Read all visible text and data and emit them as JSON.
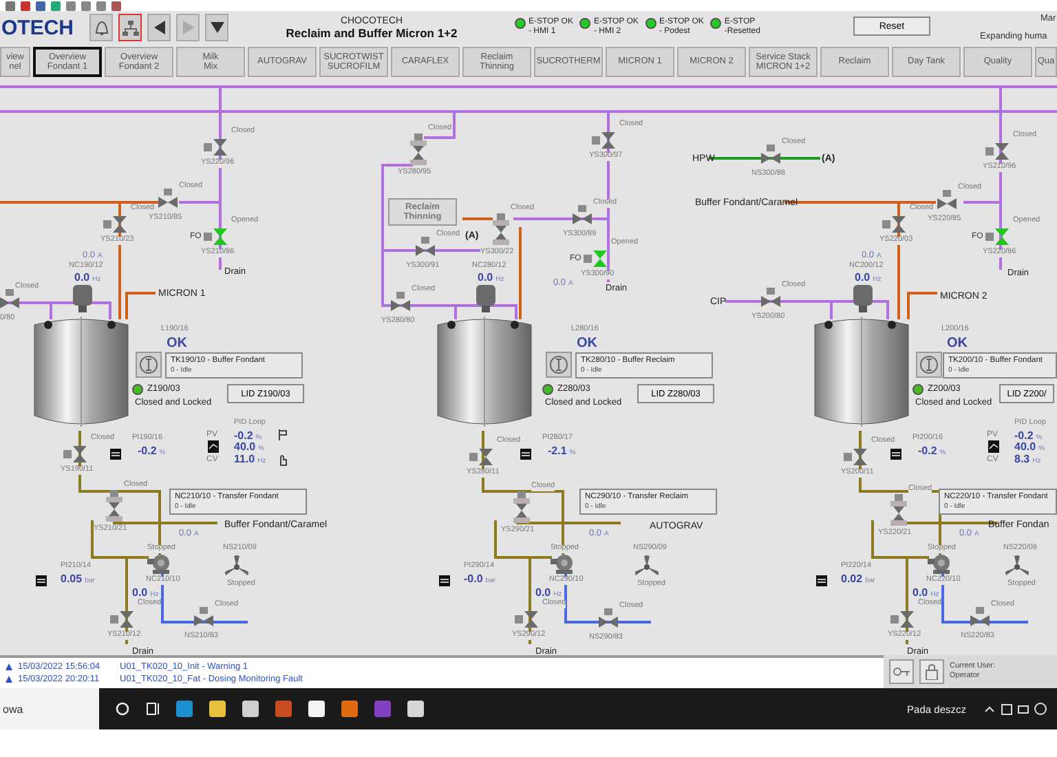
{
  "header": {
    "logo": "OTECH",
    "title_top": "CHOCOTECH",
    "title": "Reclaim and Buffer Micron 1+2",
    "estops": [
      {
        "label": "E-STOP OK",
        "sub": "- HMI 1",
        "color": "#22cc22"
      },
      {
        "label": "E-STOP OK",
        "sub": "- HMI 2",
        "color": "#22cc22"
      },
      {
        "label": "E-STOP OK",
        "sub": "- Podest",
        "color": "#22cc22"
      },
      {
        "label": "E-STOP",
        "sub": "-Resetted",
        "color": "#22cc22"
      }
    ],
    "reset": "Reset",
    "user_short": "Mar",
    "project": "Expanding huma"
  },
  "nav_tabs": [
    {
      "lines": [
        "view",
        "nel"
      ],
      "selected": false
    },
    {
      "lines": [
        "Overview",
        "Fondant 1"
      ],
      "selected": true
    },
    {
      "lines": [
        "Overview",
        "Fondant 2"
      ],
      "selected": false
    },
    {
      "lines": [
        "Milk",
        "Mix"
      ],
      "selected": false
    },
    {
      "lines": [
        "AUTOGRAV"
      ],
      "selected": false
    },
    {
      "lines": [
        "SUCROTWIST",
        "SUCROFILM"
      ],
      "selected": false
    },
    {
      "lines": [
        "CARAFLEX"
      ],
      "selected": false
    },
    {
      "lines": [
        "Reclaim",
        "Thinning"
      ],
      "selected": false
    },
    {
      "lines": [
        "SUCROTHERM"
      ],
      "selected": false
    },
    {
      "lines": [
        "MICRON 1"
      ],
      "selected": false
    },
    {
      "lines": [
        "MICRON 2"
      ],
      "selected": false
    },
    {
      "lines": [
        "Service Stack",
        "MICRON 1+2"
      ],
      "selected": false
    },
    {
      "lines": [
        "Reclaim"
      ],
      "selected": false
    },
    {
      "lines": [
        "Day Tank"
      ],
      "selected": false
    },
    {
      "lines": [
        "Quality"
      ],
      "selected": false
    },
    {
      "lines": [
        "Qua"
      ],
      "selected": false
    }
  ],
  "diagram": {
    "tanks": [
      {
        "level_tag": "L190/16",
        "level_status": "OK"
      },
      {
        "level_tag": "L280/16",
        "level_status": "OK"
      },
      {
        "level_tag": "L200/16",
        "level_status": "OK"
      }
    ],
    "motors": [
      {
        "tag": "NC190/12",
        "value": "0.0",
        "unit": "Hz"
      },
      {
        "tag": "NC280/12",
        "value": "0.0",
        "unit": "Hz"
      },
      {
        "tag": "NC200/12",
        "value": "0.0",
        "unit": "Hz"
      }
    ],
    "motor_currents": [
      {
        "value": "0.0",
        "unit": "A"
      },
      {
        "value": "0.0",
        "unit": "A"
      },
      {
        "value": "0.0",
        "unit": "A"
      }
    ],
    "tank_panels": [
      {
        "title": "TK190/10 - Buffer Fondant",
        "status": "0 - Idle"
      },
      {
        "title": "TK280/10 - Buffer Reclaim",
        "status": "0 - Idle"
      },
      {
        "title": "TK200/10 - Buffer Fondant",
        "status": "0 - Idle"
      }
    ],
    "locks": [
      {
        "tag": "Z190/03",
        "status": "Closed and Locked",
        "locked": true,
        "button": "LID Z190/03"
      },
      {
        "tag": "Z280/03",
        "status": "Closed and Locked",
        "locked": true,
        "button": "LID Z280/03"
      },
      {
        "tag": "Z200/03",
        "status": "Closed and Locked",
        "locked": true,
        "button": "LID Z200/"
      }
    ],
    "level_readings": [
      {
        "tag": "PI190/16",
        "value": "-0.2",
        "unit": "%"
      },
      {
        "tag": "PI280/17",
        "value": "-2.1",
        "unit": "%"
      },
      {
        "tag": "PI200/16",
        "value": "-0.2",
        "unit": "%"
      }
    ],
    "pid_loops": [
      {
        "title": "PID Loop",
        "pv_label": "PV",
        "pv": "-0.2",
        "pv_unit": "%",
        "sp": "40.0",
        "sp_unit": "%",
        "cv_label": "CV",
        "cv": "11.0",
        "cv_unit": "Hz"
      },
      {
        "title": "PID Loop",
        "pv_label": "PV",
        "pv": "-0.2",
        "pv_unit": "%",
        "sp": "40.0",
        "sp_unit": "%",
        "cv_label": "CV",
        "cv": "8.3",
        "cv_unit": "Hz"
      }
    ],
    "transfer_panels": [
      {
        "title": "NC210/10 - Transfer Fondant",
        "status": "0 - Idle"
      },
      {
        "title": "NC290/10 - Transfer Reclaim",
        "status": "0 - Idle"
      },
      {
        "title": "NC220/10 - Transfer Fondant",
        "status": "0 - Idle"
      }
    ],
    "pump_currents": [
      {
        "value": "0.0",
        "unit": "A"
      },
      {
        "value": "0.0",
        "unit": "A"
      },
      {
        "value": "0.0",
        "unit": "A"
      }
    ],
    "pumps": [
      {
        "tag": "NC210/10",
        "state": "Stopped",
        "value": "0.0",
        "unit": "Hz"
      },
      {
        "tag": "NC290/10",
        "state": "Stopped",
        "value": "0.0",
        "unit": "Hz"
      },
      {
        "tag": "NC220/10",
        "state": "Stopped",
        "value": "0.0",
        "unit": "Hz"
      }
    ],
    "fans": [
      {
        "tag": "NS210/09",
        "state": "Stopped"
      },
      {
        "tag": "NS290/09",
        "state": "Stopped"
      },
      {
        "tag": "NS220/09",
        "state": "Stopped"
      }
    ],
    "pressures": [
      {
        "tag": "PI210/14",
        "value": "0.05",
        "unit": "bar"
      },
      {
        "tag": "PI290/14",
        "value": "-0.0",
        "unit": "bar"
      },
      {
        "tag": "PI220/14",
        "value": "0.02",
        "unit": "bar"
      }
    ],
    "valves": [
      {
        "tag": "YS220/96",
        "state": "Closed",
        "open": false
      },
      {
        "tag": "YS210/85",
        "state": "Closed",
        "open": false
      },
      {
        "tag": "YS210/23",
        "state": "Closed",
        "open": false
      },
      {
        "tag": "YS210/86",
        "state": "Opened",
        "open": true,
        "prefix": "FO"
      },
      {
        "tag": "0/80",
        "state": "Closed",
        "open": false
      },
      {
        "tag": "YS190/11",
        "state": "Closed",
        "open": false
      },
      {
        "tag": "YS210/21",
        "state": "Closed",
        "open": false
      },
      {
        "tag": "YS210/12",
        "state": "Closed",
        "open": false
      },
      {
        "tag": "NS210/83",
        "state": "Closed",
        "open": false
      },
      {
        "tag": "YS280/95",
        "state": "Closed",
        "open": false
      },
      {
        "tag": "YS300/97",
        "state": "Closed",
        "open": false
      },
      {
        "tag": "YS300/89",
        "state": "Closed",
        "open": false
      },
      {
        "tag": "YS300/22",
        "state": "Closed",
        "open": false
      },
      {
        "tag": "YS300/91",
        "state": "Closed",
        "open": false
      },
      {
        "tag": "YS300/90",
        "state": "Opened",
        "open": true,
        "prefix": "FO"
      },
      {
        "tag": "YS280/80",
        "state": "Closed",
        "open": false
      },
      {
        "tag": "YS280/11",
        "state": "Closed",
        "open": false
      },
      {
        "tag": "YS290/21",
        "state": "Closed",
        "open": false
      },
      {
        "tag": "YS290/12",
        "state": "Closed",
        "open": false
      },
      {
        "tag": "NS290/83",
        "state": "Closed",
        "open": false
      },
      {
        "tag": "NS300/88",
        "state": "Closed",
        "open": false
      },
      {
        "tag": "YS210/96",
        "state": "Closed",
        "open": false
      },
      {
        "tag": "YS220/85",
        "state": "Closed",
        "open": false
      },
      {
        "tag": "YS220/03",
        "state": "Closed",
        "open": false
      },
      {
        "tag": "YS220/86",
        "state": "Opened",
        "open": true,
        "prefix": "FO"
      },
      {
        "tag": "YS200/80",
        "state": "Closed",
        "open": false
      },
      {
        "tag": "YS200/11",
        "state": "Closed",
        "open": false
      },
      {
        "tag": "YS220/21",
        "state": "Closed",
        "open": false
      },
      {
        "tag": "YS220/12",
        "state": "Closed",
        "open": false
      },
      {
        "tag": "NS220/83",
        "state": "Closed",
        "open": false
      }
    ],
    "labels": [
      {
        "kind": "destination",
        "text": "MICRON 1"
      },
      {
        "kind": "drain",
        "text": "Drain"
      },
      {
        "kind": "drain",
        "text": "Drain"
      },
      {
        "kind": "destination",
        "text": "Buffer Fondant/Caramel"
      },
      {
        "kind": "junction",
        "text": "(A)"
      },
      {
        "kind": "drain",
        "text": "Drain"
      },
      {
        "kind": "destination",
        "text": "AUTOGRAV"
      },
      {
        "kind": "drain",
        "text": "Drain"
      },
      {
        "kind": "destination",
        "text": "HPW"
      },
      {
        "kind": "junction",
        "text": "(A)"
      },
      {
        "kind": "destination",
        "text": "Buffer Fondant/Caramel"
      },
      {
        "kind": "destination",
        "text": "CIP"
      },
      {
        "kind": "destination",
        "text": "MICRON 2"
      },
      {
        "kind": "drain",
        "text": "Drain"
      },
      {
        "kind": "destination",
        "text": "Buffer Fondan"
      },
      {
        "kind": "drain",
        "text": "Drain"
      }
    ],
    "link_button": {
      "lines": [
        "Reclaim",
        "Thinning"
      ]
    }
  },
  "alarms": [
    {
      "time": "15/03/2022 15:56:04",
      "text": "U01_TK020_10_Init - Warning 1"
    },
    {
      "time": "15/03/2022 20:20:11",
      "text": "U01_TK020_10_Fat - Dosing Monitoring Fault"
    }
  ],
  "user": {
    "label": "Current User:",
    "name": "Operator"
  },
  "taskbar": {
    "search": "owa",
    "weather": "Pada deszcz"
  }
}
